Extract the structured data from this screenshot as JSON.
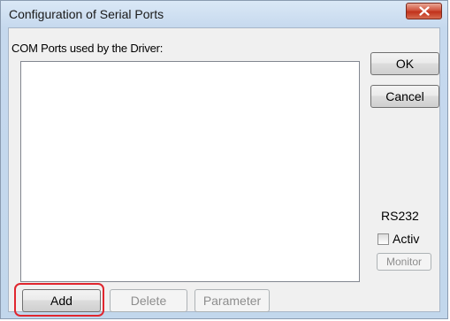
{
  "window": {
    "title": "Configuration of Serial Ports",
    "close_icon": "close-x-icon"
  },
  "ports": {
    "label": "COM Ports used by the Driver:",
    "items": []
  },
  "buttons": {
    "ok": "OK",
    "cancel": "Cancel",
    "add": "Add",
    "delete": "Delete",
    "parameter": "Parameter",
    "monitor": "Monitor"
  },
  "rs232": {
    "label": "RS232",
    "activ_label": "Activ",
    "activ_checked": false
  },
  "colors": {
    "highlight": "#e0262e",
    "close_button": "#c1321b"
  }
}
